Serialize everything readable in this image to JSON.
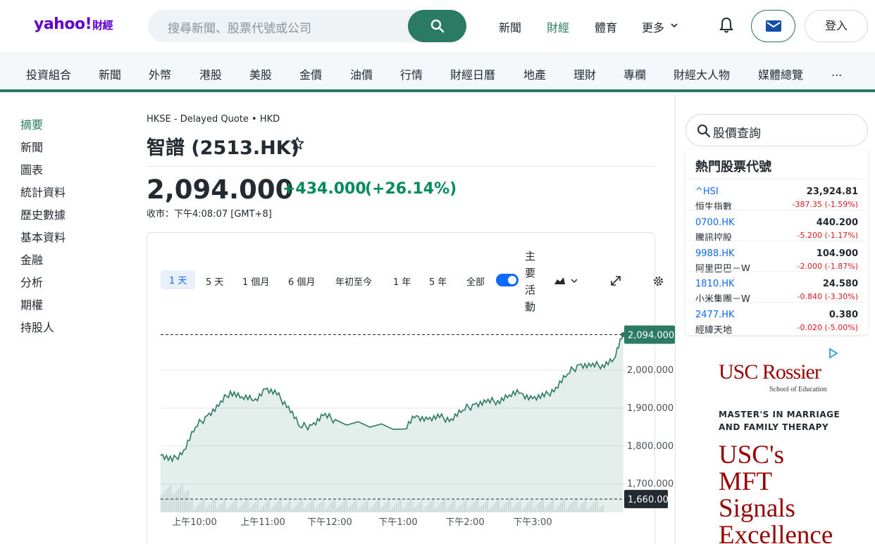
{
  "header": {
    "logo_text": "yahoo!",
    "logo_suffix": "財經",
    "search_placeholder": "搜尋新聞、股票代號或公司",
    "nav": [
      "新聞",
      "財經",
      "體育",
      "更多"
    ],
    "active_nav": "財經",
    "login_label": "登入"
  },
  "subnav": [
    "投資組合",
    "新聞",
    "外幣",
    "港股",
    "美股",
    "金價",
    "油價",
    "行情",
    "財經日曆",
    "地產",
    "理財",
    "專欄",
    "財經大人物",
    "媒體總覽",
    "..."
  ],
  "side_menu": {
    "items": [
      "摘要",
      "新聞",
      "圖表",
      "統計資料",
      "歷史數據",
      "基本資料",
      "金融",
      "分析",
      "期權",
      "持股人"
    ],
    "active": "摘要"
  },
  "quote": {
    "meta": "HKSE - Delayed Quote • HKD",
    "title": "智譜 (2513.HK)",
    "price": "2,094.000",
    "change": "+434.000",
    "change_pct": "(+26.14%)",
    "timestamp": "收市：下午4:08:07 [GMT+8]"
  },
  "chart_controls": {
    "ranges": [
      "1 天",
      "5 天",
      "1 個月",
      "6 個月",
      "年初至今",
      "1 年",
      "5 年",
      "全部"
    ],
    "active_range": "1 天",
    "events_label": "主要活動",
    "events_toggle_on": true
  },
  "chart_data": {
    "type": "area",
    "x": [
      "09:30",
      "09:40",
      "09:50",
      "10:00",
      "10:10",
      "10:20",
      "10:30",
      "10:40",
      "10:50",
      "11:00",
      "11:10",
      "11:20",
      "11:30",
      "11:40",
      "11:50",
      "12:00",
      "13:00",
      "13:10",
      "13:20",
      "13:30",
      "13:40",
      "13:50",
      "14:00",
      "14:10",
      "14:20",
      "14:30",
      "14:40",
      "14:50",
      "15:00",
      "15:10",
      "15:20",
      "15:30",
      "15:40",
      "15:50",
      "16:00",
      "16:08"
    ],
    "y": [
      1775,
      1760,
      1790,
      1850,
      1880,
      1905,
      1945,
      1930,
      1920,
      1950,
      1935,
      1905,
      1850,
      1855,
      1880,
      1870,
      1845,
      1880,
      1870,
      1875,
      1872,
      1895,
      1910,
      1915,
      1920,
      1935,
      1940,
      1925,
      1930,
      1955,
      1990,
      2015,
      2010,
      2015,
      2030,
      2094
    ],
    "xticks": [
      "上午10:00",
      "上午11:00",
      "下午12:00",
      "下午1:00",
      "下午2:00",
      "下午3:00"
    ],
    "yticks": [
      "1,700.000",
      "1,800.000",
      "1,900.000",
      "2,000.000"
    ],
    "ylim": [
      1625,
      2160
    ],
    "last_price_label": "2,094.000",
    "prev_close": 1660,
    "prev_close_label": "1,660.00",
    "grid": true
  },
  "trending": {
    "search_placeholder": "股價查詢",
    "title": "熱門股票代號",
    "rows": [
      {
        "symbol": "^HSI",
        "name": "恒生指數",
        "price": "23,924.81",
        "change": "-387.35  (-1.59%)"
      },
      {
        "symbol": "0700.HK",
        "name": "騰訊控股",
        "price": "440.200",
        "change": "-5.200  (-1.17%)"
      },
      {
        "symbol": "9988.HK",
        "name": "阿里巴巴－W",
        "price": "104.900",
        "change": "-2.000  (-1.87%)"
      },
      {
        "symbol": "1810.HK",
        "name": "小米集團－W",
        "price": "24.580",
        "change": "-0.840  (-3.30%)"
      },
      {
        "symbol": "2477.HK",
        "name": "經緯天地",
        "price": "0.380",
        "change": "-0.020  (-5.00%)"
      }
    ]
  },
  "ad": {
    "brand": "USC Rossier",
    "school": "School of Education",
    "line1": "MASTER'S IN MARRIAGE",
    "line2": "AND FAMILY THERAPY",
    "big": [
      "USC's",
      "MFT",
      "Signals",
      "Excellence"
    ]
  },
  "colors": {
    "accent": "#2b7a63",
    "up": "#008a5e",
    "down": "#e0181d",
    "link": "#0f69ff"
  }
}
